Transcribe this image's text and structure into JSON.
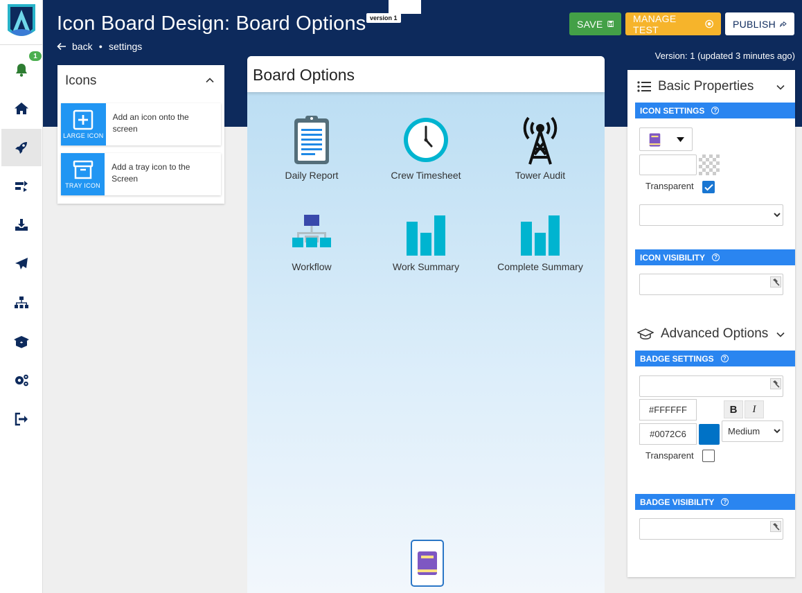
{
  "header": {
    "title": "Icon Board Design: Board Options",
    "version_tag": "version 1",
    "breadcrumb": {
      "back": "back",
      "current": "settings"
    },
    "buttons": {
      "save": "SAVE",
      "manage_test": "MANAGE TEST",
      "publish": "PUBLISH"
    },
    "version_line": "Version: 1 (updated 3 minutes ago)"
  },
  "nav": {
    "notification_count": "1",
    "items": [
      {
        "icon": "bell-icon"
      },
      {
        "icon": "home-icon"
      },
      {
        "icon": "rocket-icon"
      },
      {
        "icon": "transfer-icon"
      },
      {
        "icon": "download-tray-icon"
      },
      {
        "icon": "paper-plane-icon"
      },
      {
        "icon": "org-chart-icon"
      },
      {
        "icon": "open-box-icon"
      },
      {
        "icon": "gears-icon"
      },
      {
        "icon": "sign-out-icon"
      }
    ]
  },
  "icons_panel": {
    "title": "Icons",
    "tools": [
      {
        "badge": "LARGE ICON",
        "text": "Add an icon onto the screen"
      },
      {
        "badge": "TRAY ICON",
        "text": "Add a tray icon to the Screen"
      }
    ]
  },
  "board": {
    "title": "Board Options",
    "tiles": [
      {
        "label": "Daily Report",
        "icon": "clipboard-icon"
      },
      {
        "label": "Crew Timesheet",
        "icon": "clock-icon"
      },
      {
        "label": "Tower Audit",
        "icon": "tower-icon"
      },
      {
        "label": "Workflow",
        "icon": "workflow-icon"
      },
      {
        "label": "Work Summary",
        "icon": "bar-chart-icon"
      },
      {
        "label": "Complete Summary",
        "icon": "bar-chart-icon"
      }
    ],
    "tray_icon": "book-icon"
  },
  "properties": {
    "basic_title": "Basic Properties",
    "icon_settings": "ICON SETTINGS",
    "transparent_label": "Transparent",
    "icon_visibility": "ICON VISIBILITY",
    "advanced_title": "Advanced Options",
    "badge_settings": "BADGE SETTINGS",
    "badge_text_color": "#FFFFFF",
    "badge_bg_color": "#0072C6",
    "bold_label": "B",
    "italic_label": "I",
    "size_value": "Medium",
    "badge_transparent_label": "Transparent",
    "badge_visibility": "BADGE VISIBILITY"
  },
  "colors": {
    "header_bg": "#0d2a5c",
    "save": "#43a047",
    "manage": "#f6b42b",
    "accent": "#2196f3",
    "section_bar": "#2a85f0",
    "tile_cyan": "#00b4d0"
  }
}
